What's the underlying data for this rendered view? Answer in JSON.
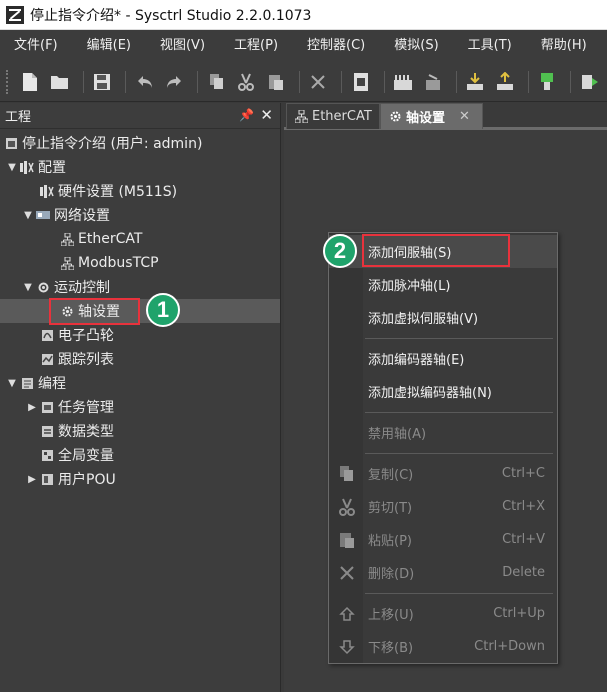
{
  "window": {
    "title": "停止指令介绍* - Sysctrl Studio 2.2.0.1073"
  },
  "menubar": {
    "items": [
      "文件(F)",
      "编辑(E)",
      "视图(V)",
      "工程(P)",
      "控制器(C)",
      "模拟(S)",
      "工具(T)",
      "帮助(H)"
    ]
  },
  "project_panel": {
    "title": "工程",
    "pin_icon": "pin-icon",
    "close_icon": "close-icon",
    "tree": [
      {
        "label": "停止指令介绍 (用户: admin)",
        "icon": "project-icon"
      },
      {
        "label": "配置",
        "icon": "config-icon"
      },
      {
        "label": "硬件设置 (M511S)",
        "icon": "hardware-icon"
      },
      {
        "label": "网络设置",
        "icon": "network-icon"
      },
      {
        "label": "EtherCAT",
        "icon": "network-node-icon"
      },
      {
        "label": "ModbusTCP",
        "icon": "network-node-icon"
      },
      {
        "label": "运动控制",
        "icon": "motion-icon"
      },
      {
        "label": "轴设置",
        "icon": "gear-icon"
      },
      {
        "label": "电子凸轮",
        "icon": "cam-icon"
      },
      {
        "label": "跟踪列表",
        "icon": "trace-icon"
      },
      {
        "label": "编程",
        "icon": "program-icon"
      },
      {
        "label": "任务管理",
        "icon": "task-icon"
      },
      {
        "label": "数据类型",
        "icon": "datatype-icon"
      },
      {
        "label": "全局变量",
        "icon": "global-var-icon"
      },
      {
        "label": "用户POU",
        "icon": "pou-icon"
      }
    ]
  },
  "tabs": [
    {
      "label": "EtherCAT",
      "active": false
    },
    {
      "label": "轴设置",
      "active": true
    }
  ],
  "context_menu": {
    "items": [
      {
        "label": "添加伺服轴(S)",
        "shortcut": "",
        "enabled": true
      },
      {
        "label": "添加脉冲轴(L)",
        "shortcut": "",
        "enabled": true
      },
      {
        "label": "添加虚拟伺服轴(V)",
        "shortcut": "",
        "enabled": true
      },
      {
        "label": "添加编码器轴(E)",
        "shortcut": "",
        "enabled": true
      },
      {
        "label": "添加虚拟编码器轴(N)",
        "shortcut": "",
        "enabled": true
      },
      {
        "label": "禁用轴(A)",
        "shortcut": "",
        "enabled": false
      },
      {
        "label": "复制(C)",
        "shortcut": "Ctrl+C",
        "enabled": false,
        "icon": "copy-icon"
      },
      {
        "label": "剪切(T)",
        "shortcut": "Ctrl+X",
        "enabled": false,
        "icon": "cut-icon"
      },
      {
        "label": "粘贴(P)",
        "shortcut": "Ctrl+V",
        "enabled": false,
        "icon": "paste-icon"
      },
      {
        "label": "删除(D)",
        "shortcut": "Delete",
        "enabled": false,
        "icon": "delete-icon"
      },
      {
        "label": "上移(U)",
        "shortcut": "Ctrl+Up",
        "enabled": false,
        "icon": "move-up-icon"
      },
      {
        "label": "下移(B)",
        "shortcut": "Ctrl+Down",
        "enabled": false,
        "icon": "move-down-icon"
      }
    ]
  },
  "annotations": [
    {
      "number": "1",
      "color": "#1fa36b"
    },
    {
      "number": "2",
      "color": "#1fa36b"
    }
  ],
  "colors": {
    "highlight": "#e8323c",
    "callout": "#1fa36b",
    "background": "#3d3d3d"
  }
}
